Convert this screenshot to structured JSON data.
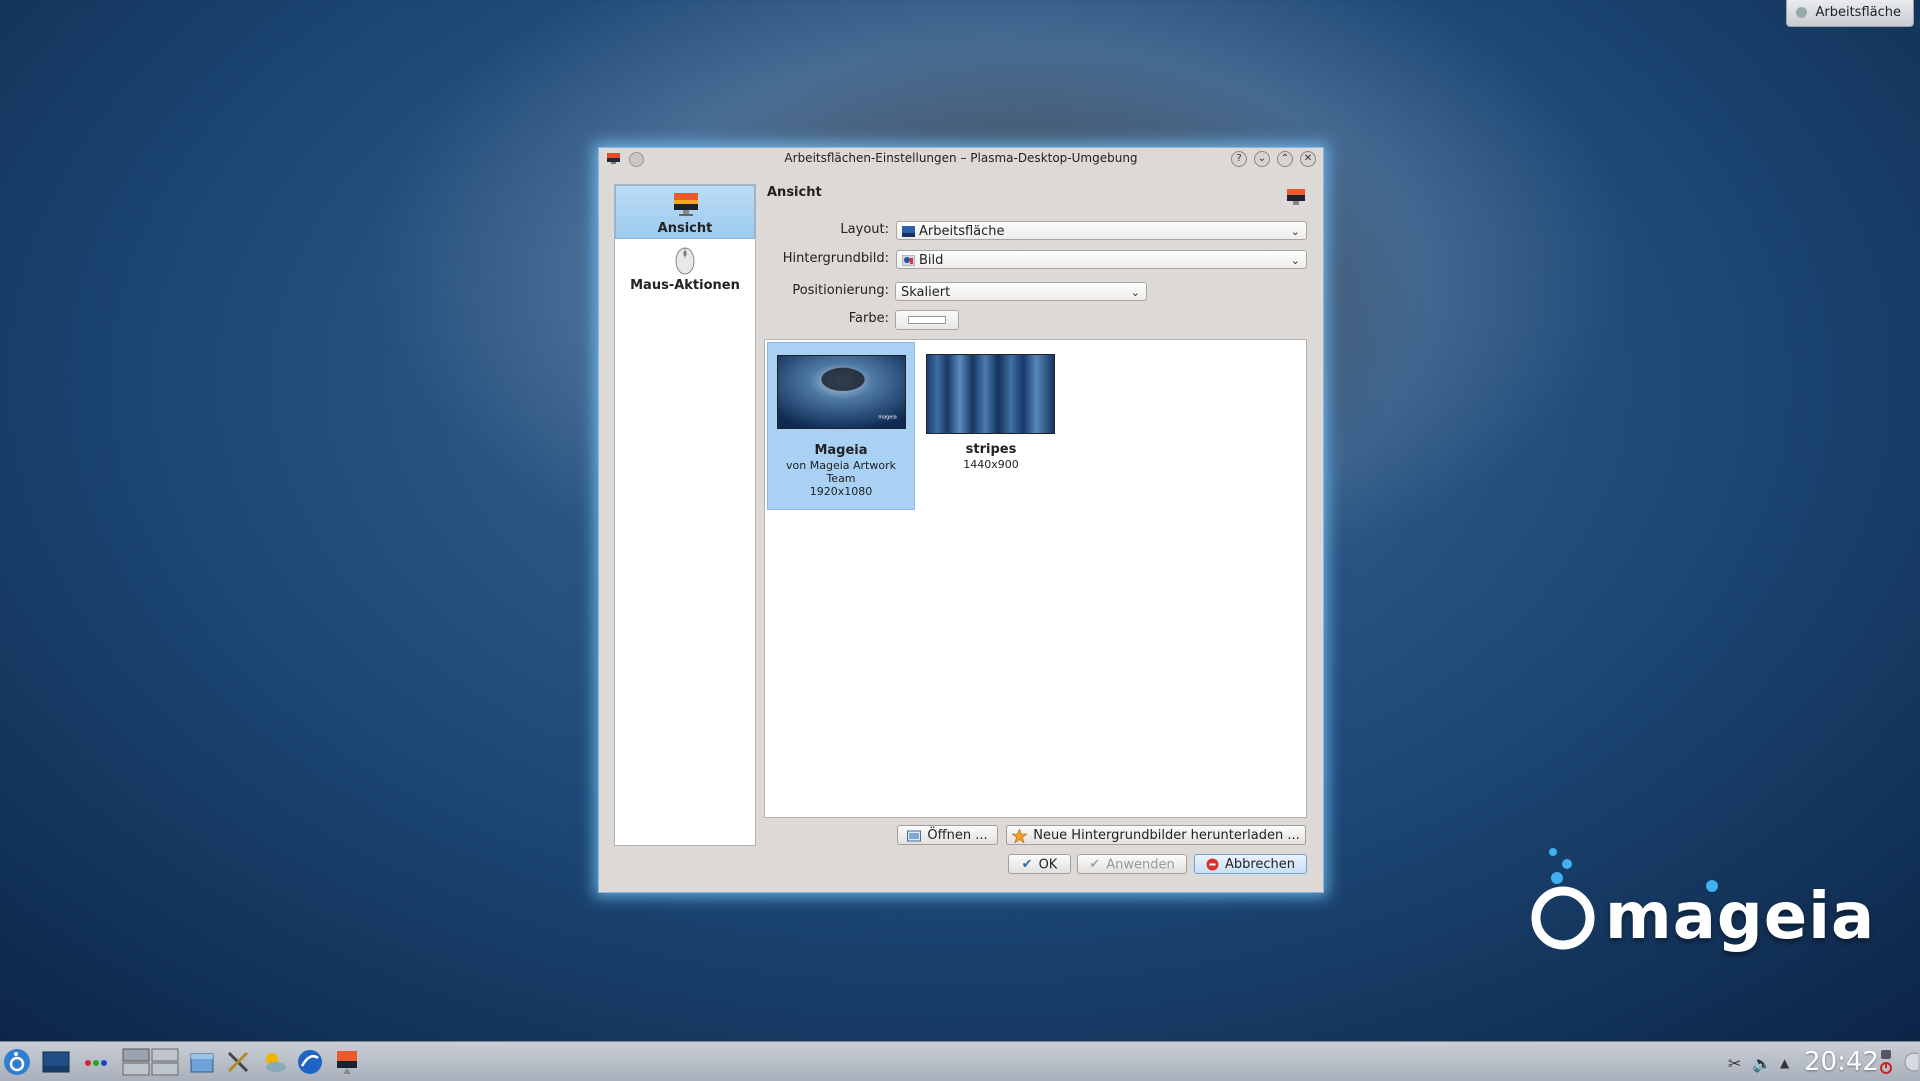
{
  "desktop": {
    "top_button_label": "Arbeitsfläche",
    "logo_text": "mageia"
  },
  "dialog": {
    "title": "Arbeitsflächen-Einstellungen – Plasma-Desktop-Umgebung",
    "sidebar": [
      {
        "label": "Ansicht",
        "icon": "display-icon",
        "active": true
      },
      {
        "label": "Maus-Aktionen",
        "icon": "mouse-icon",
        "active": false
      }
    ],
    "section_title": "Ansicht",
    "form": {
      "layout_label": "Layout:",
      "layout_value": "Arbeitsfläche",
      "wallpaper_label": "Hintergrundbild:",
      "wallpaper_value": "Bild",
      "positioning_label": "Positionierung:",
      "positioning_value": "Skaliert",
      "color_label": "Farbe:"
    },
    "wallpapers": [
      {
        "name": "Mageia",
        "author": "von Mageia Artwork Team",
        "resolution": "1920x1080",
        "selected": true
      },
      {
        "name": "stripes",
        "author": "",
        "resolution": "1440x900",
        "selected": false
      }
    ],
    "buttons": {
      "open": "Öffnen ...",
      "download": "Neue Hintergrundbilder herunterladen ...",
      "ok": "OK",
      "apply": "Anwenden",
      "cancel": "Abbrechen"
    }
  },
  "taskbar": {
    "clock": "20:42",
    "launchers": [
      "mageia-menu-icon",
      "desktop-icon",
      "activity-icon",
      "pager-icon",
      "file-manager-icon",
      "tools-icon",
      "weather-icon",
      "browser-icon",
      "settings-icon"
    ]
  },
  "colors": {
    "selection": "#a9d1f3",
    "dialog_bg": "#dcd9d6",
    "glow": "#78c8ff"
  }
}
